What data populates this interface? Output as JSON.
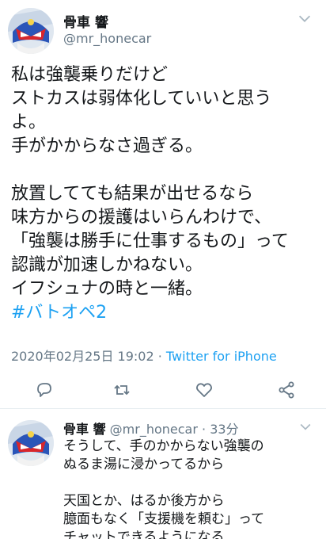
{
  "tweet": {
    "display_name": "骨車 響",
    "handle": "@mr_honecar",
    "text_lines": [
      "私は強襲乗りだけど",
      "ストカスは弱体化していいと思う",
      "よ。",
      "手がかからなさ過ぎる。",
      "",
      "放置してても結果が出せるなら",
      "味方からの援護はいらんわけで、",
      "「強襲は勝手に仕事するもの」って",
      "認識が加速しかねない。",
      "イフシュナの時と一緒。"
    ],
    "hashtag": "#バトオペ2",
    "timestamp": "2020年02月25日 19:02",
    "separator": " · ",
    "source": "Twitter for iPhone",
    "icons": {
      "menu": "chevron-down-icon",
      "reply": "reply-icon",
      "retweet": "retweet-icon",
      "like": "heart-icon",
      "share": "share-icon"
    }
  },
  "reply": {
    "display_name": "骨車 響",
    "handle": "@mr_honecar",
    "separator": " · ",
    "time": "33分",
    "text_lines": [
      "そうして、手のかからない強襲の",
      "ぬるま湯に浸かってるから",
      "",
      "天国とか、はるか後方から",
      "臆面もなく「支援機を頼む」って",
      "チャットできるようになる"
    ]
  },
  "colors": {
    "accent": "#1da1f2",
    "muted": "#657786",
    "text": "#14171a"
  }
}
